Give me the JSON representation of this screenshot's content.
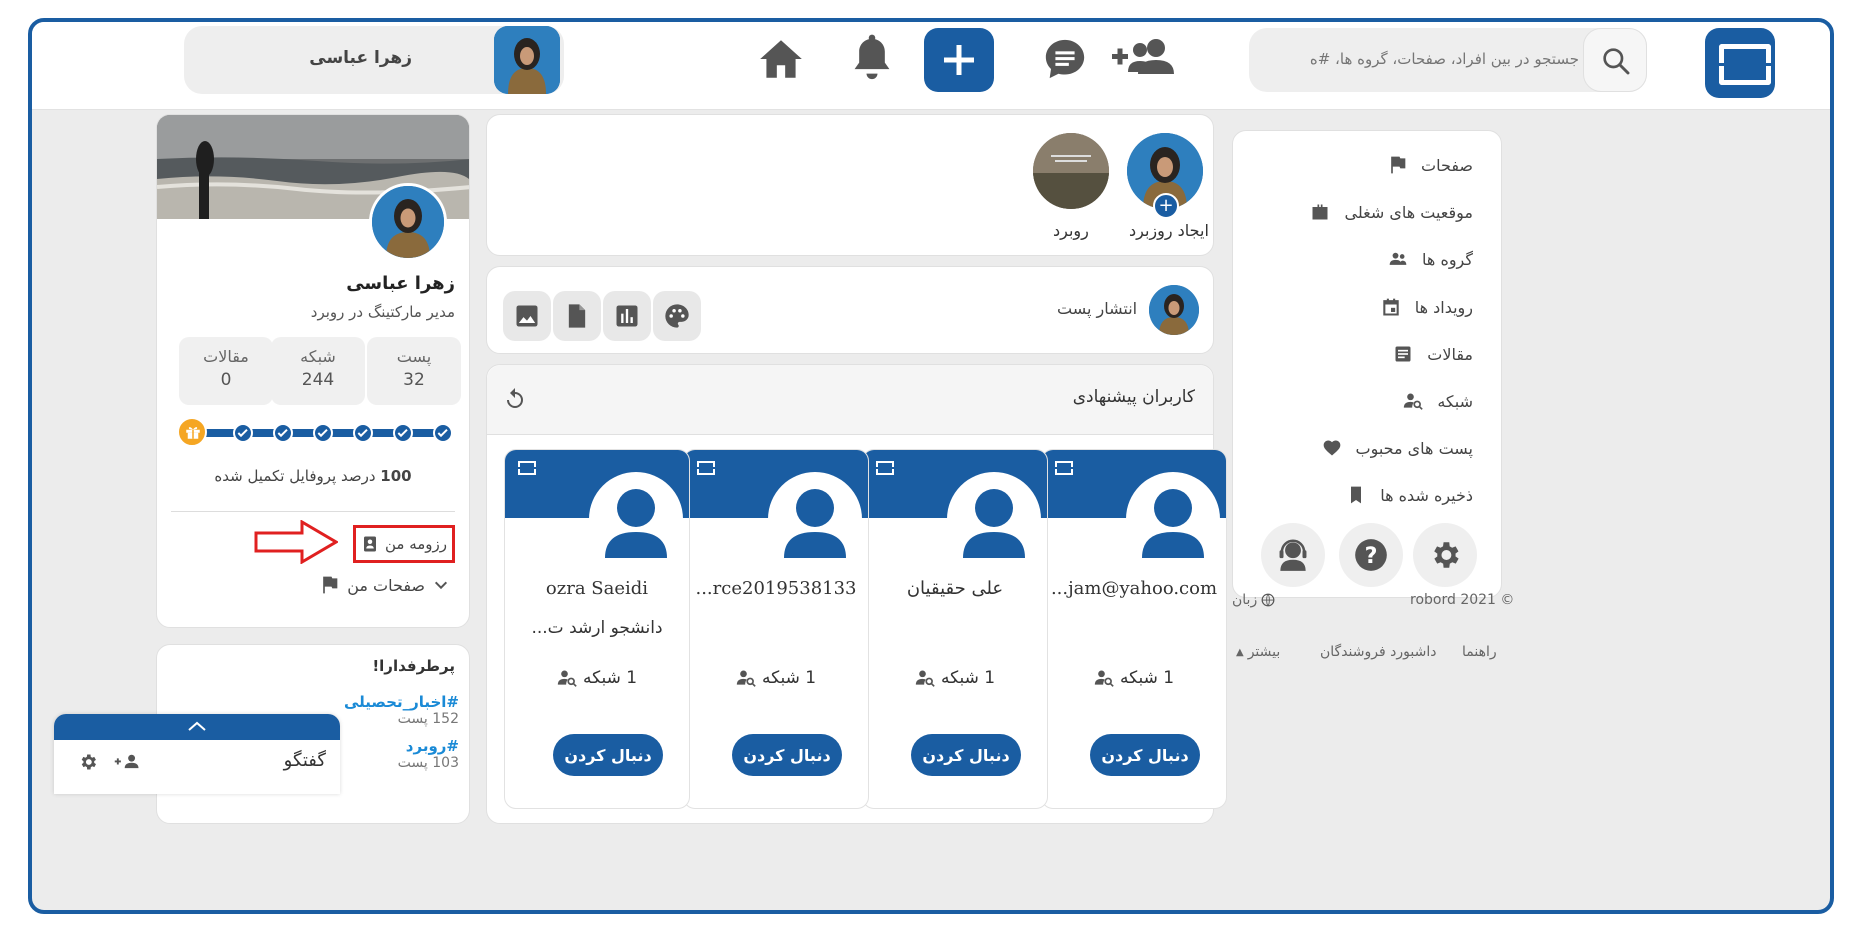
{
  "header": {
    "search_placeholder": "جستجو در بین افراد، صفحات، گروه ها، #ه",
    "profile_name": "زهرا عباسی"
  },
  "sidebar": {
    "items": [
      {
        "label": "صفحات",
        "icon": "flag-icon"
      },
      {
        "label": "موقعیت های شغلی",
        "icon": "briefcase-icon"
      },
      {
        "label": "گروه ها",
        "icon": "group-icon"
      },
      {
        "label": "رویداد ها",
        "icon": "calendar-icon"
      },
      {
        "label": "مقالات",
        "icon": "article-icon"
      },
      {
        "label": "شبکه",
        "icon": "network-icon"
      },
      {
        "label": "پست های محبوب",
        "icon": "heart-icon"
      },
      {
        "label": "ذخیره شده ها",
        "icon": "bookmark-icon"
      }
    ],
    "copyright": "robord 2021 ©",
    "language": "زبان",
    "help": "راهنما",
    "seller_dashboard": "داشبورد فروشندگان",
    "more": "بیشتر"
  },
  "stories": {
    "create_label": "ایجاد روزبرد",
    "robord_label": "روبرد"
  },
  "composer": {
    "label": "انتشار پست"
  },
  "suggested": {
    "title": "کاربران پیشنهادی",
    "follow_label": "دنبال کردن",
    "users": [
      {
        "name": "...jam@yahoo.com",
        "bio": "",
        "network": "1 شبکه"
      },
      {
        "name": "علی حقیقیان",
        "bio": "",
        "network": "1 شبکه"
      },
      {
        "name": "...rce2019538133",
        "bio": "",
        "network": "1 شبکه"
      },
      {
        "name": "ozra Saeidi",
        "bio": "دانشجو ارشد ت...",
        "network": "1 شبکه"
      }
    ]
  },
  "profile": {
    "name": "زهرا عباسی",
    "title": "مدیر مارکتینگ در روبرد",
    "stats": [
      {
        "label": "پست",
        "value": "32"
      },
      {
        "label": "شبکه",
        "value": "244"
      },
      {
        "label": "مقالات",
        "value": "0"
      }
    ],
    "progress_value": "100",
    "progress_text": "درصد پروفایل تکمیل شده",
    "progress_fraction": 1.0,
    "resume_label": "رزومه من",
    "my_pages_label": "صفحات من"
  },
  "trending": {
    "title": "پرطرفدارا!",
    "items": [
      {
        "tag": "#اخبار_تحصیلی",
        "count": "152 پست"
      },
      {
        "tag": "#روبرد",
        "count": "103 پست"
      }
    ]
  },
  "chat": {
    "label": "گفتگو"
  },
  "colors": {
    "accent": "#1a5da2",
    "highlight": "#e02020",
    "gift": "#f5a623"
  }
}
